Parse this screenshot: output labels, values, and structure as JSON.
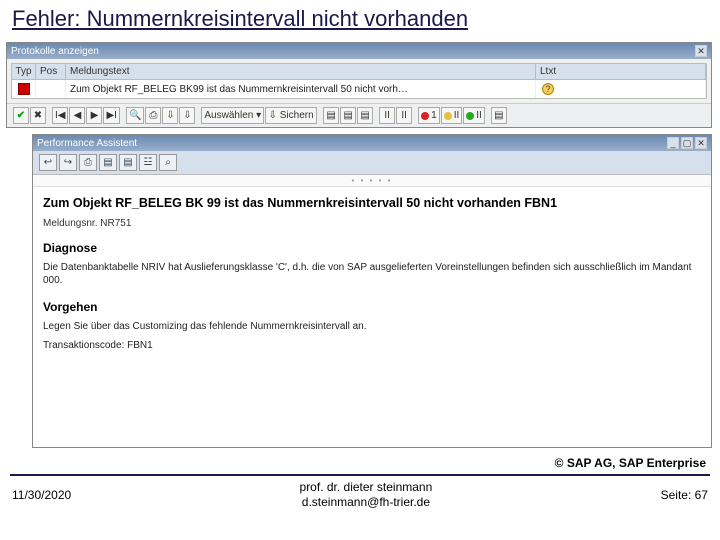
{
  "slide": {
    "title": "Fehler: Nummernkreisintervall nicht vorhanden",
    "copyright": "© SAP AG, SAP Enterprise",
    "footer_date": "11/30/2020",
    "footer_author_line1": "prof. dr. dieter steinmann",
    "footer_author_line2": "d.steinmann@fh-trier.de",
    "footer_page": "Seite: 67"
  },
  "log_window": {
    "title": "Protokolle anzeigen",
    "columns": {
      "typ": "Typ",
      "pos": "Pos",
      "msg": "Meldungstext",
      "ltxt": "Ltxt"
    },
    "row": {
      "icon": "error",
      "text": "Zum Objekt RF_BELEG BK99 ist das Nummernkreisintervall 50 nicht vorh…",
      "ltxt_icon": "?"
    },
    "toolbar": {
      "ok": "✔",
      "x": "✖",
      "first": "I◀",
      "prev": "◀",
      "next": "▶",
      "last": "▶I",
      "find": "🔍",
      "print": "⎙",
      "dl1": "⇩",
      "dl2": "⇩",
      "select_label": "Auswählen",
      "select_icon": "▾",
      "save_label": "Sichern",
      "save_icon": "⇩",
      "doc1": "▤",
      "doc2": "▤",
      "doc3": "▤",
      "f1": "II",
      "f2": "II",
      "c_red": "1",
      "c_yellow": "II",
      "c_green": "II",
      "std": "▤"
    }
  },
  "help_window": {
    "title": "Performance Assistent",
    "toolbar2": {
      "b1": "↩",
      "b2": "↪",
      "b3": "⎙",
      "b4": "▤",
      "b5": "▤",
      "b6": "☳",
      "b7": "⌕"
    },
    "heading": "Zum Objekt RF_BELEG BK 99 ist das Nummernkreisintervall 50 nicht vorhanden FBN1",
    "msgnr_label": "Meldungsnr. NR751",
    "diag_h": "Diagnose",
    "diag_p": "Die Datenbanktabelle NRIV hat Auslieferungsklasse 'C', d.h. die von SAP ausgelieferten Voreinstellungen befinden sich ausschließlich im Mandant 000.",
    "proc_h": "Vorgehen",
    "proc_p": "Legen Sie über das Customizing das fehlende Nummernkreisintervall an.",
    "tcode_p": "Transaktionscode: FBN1"
  }
}
